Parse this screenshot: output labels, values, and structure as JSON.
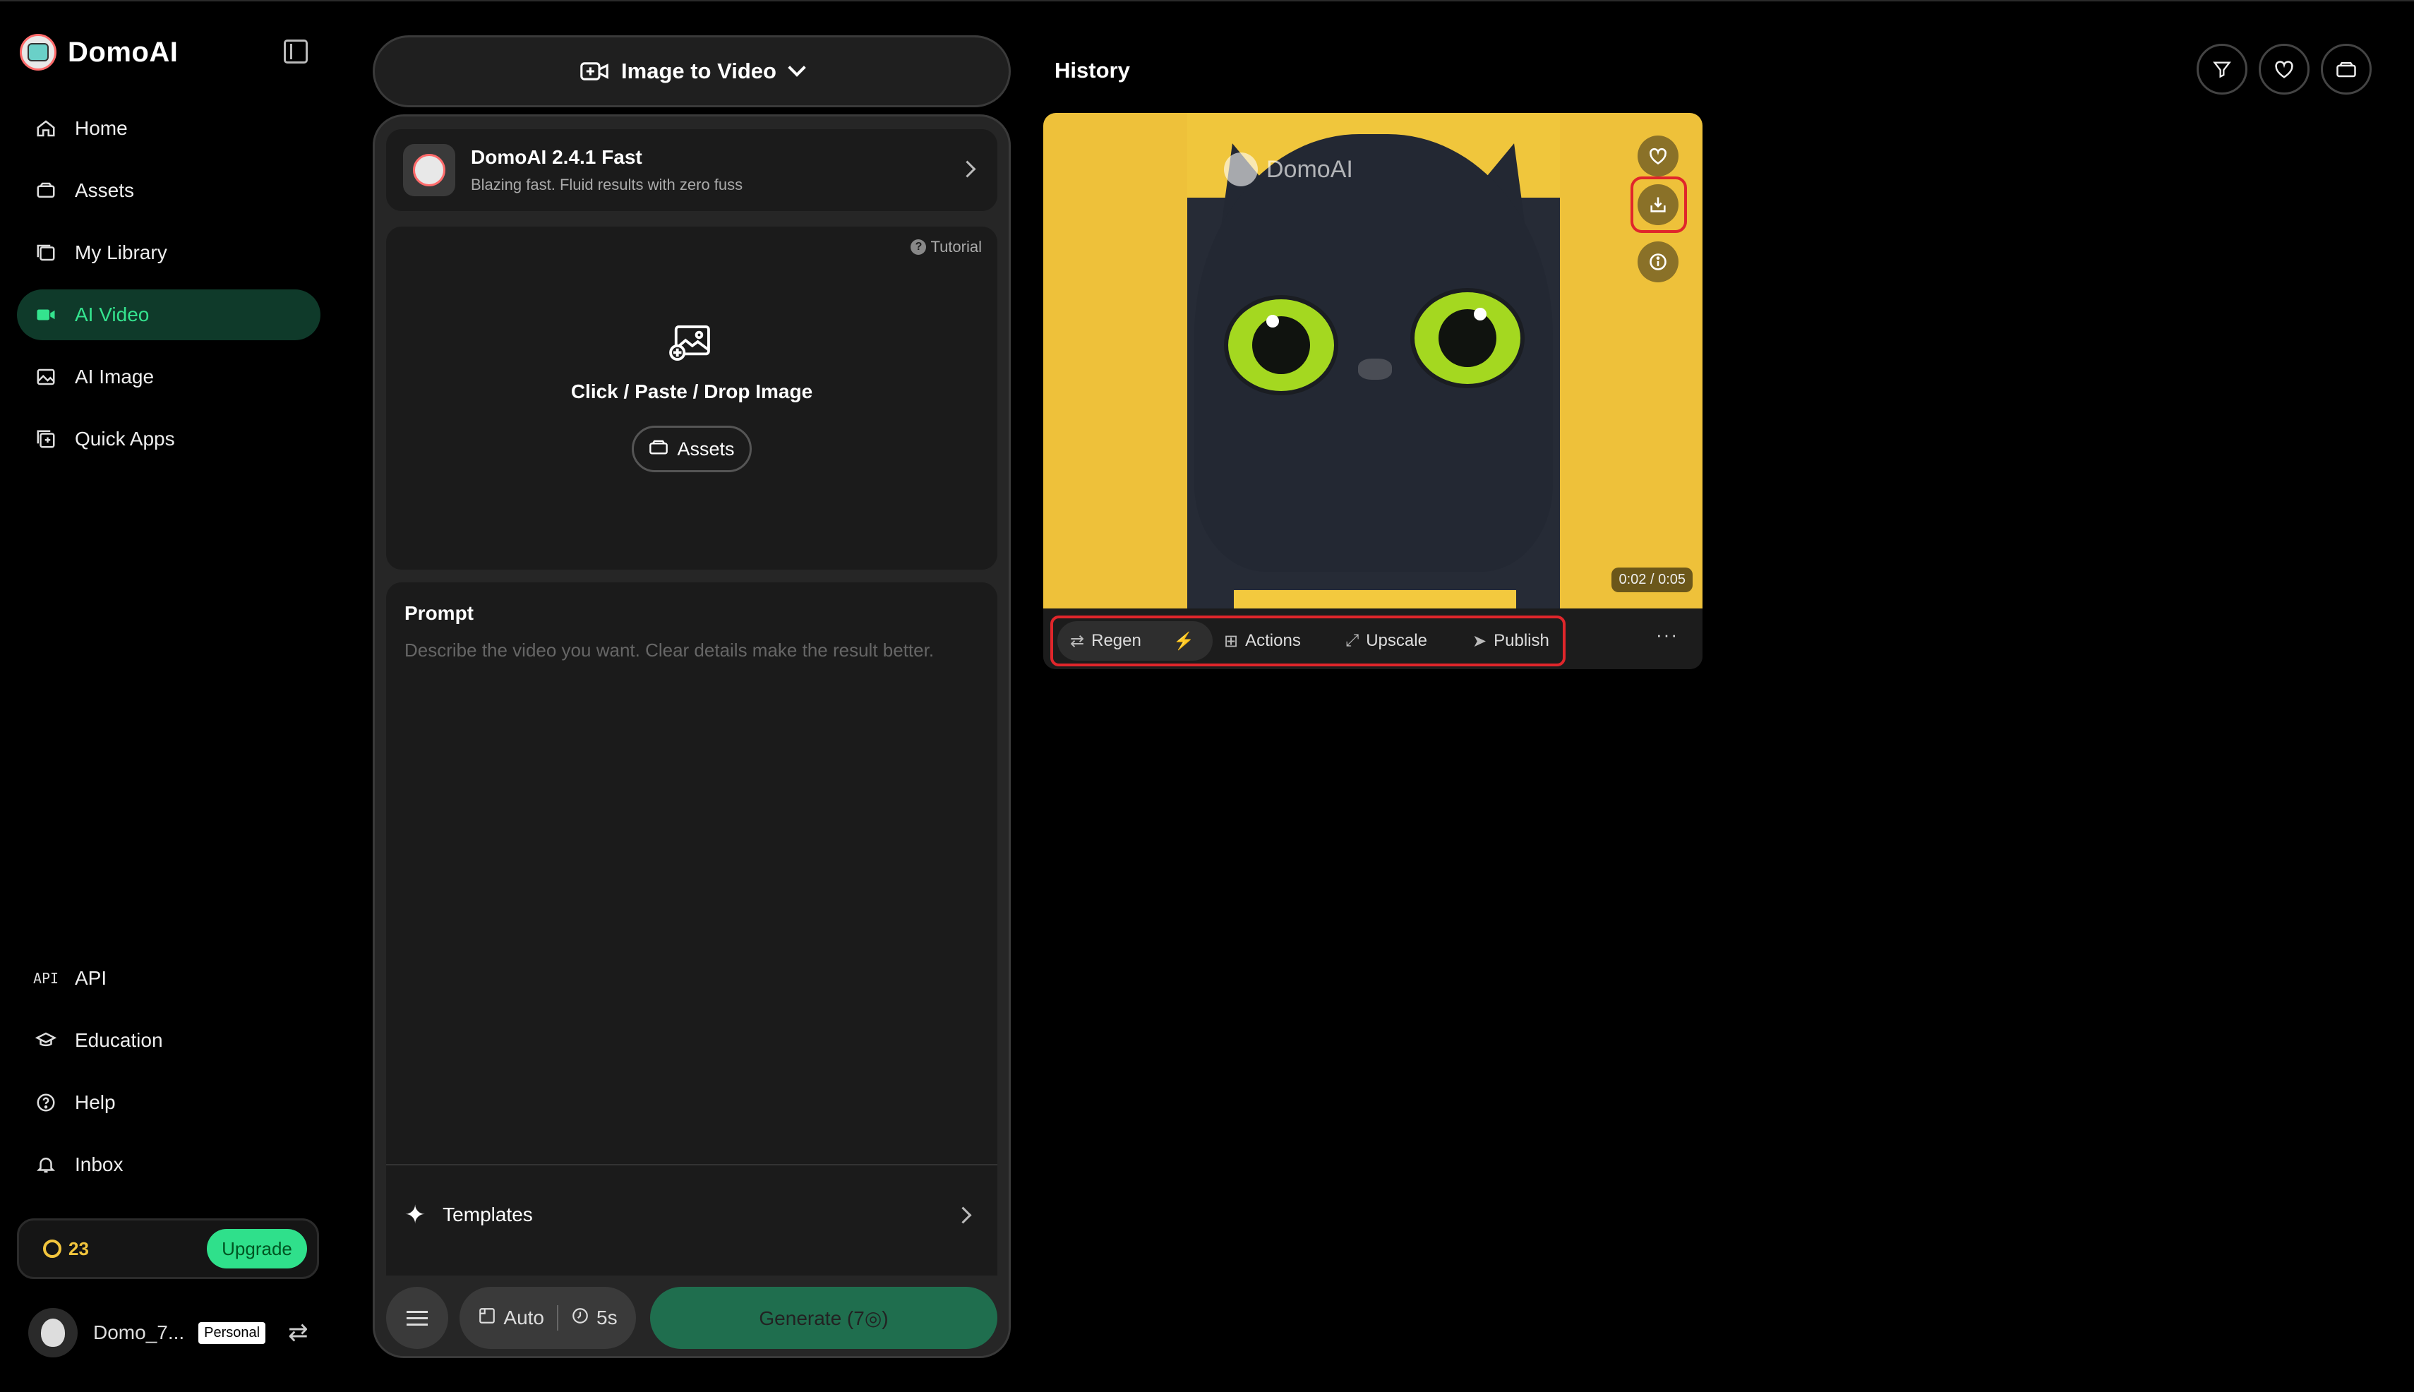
{
  "brand": {
    "name": "DomoAI"
  },
  "sidebar": {
    "nav": [
      {
        "label": "Home",
        "icon": "home-icon"
      },
      {
        "label": "Assets",
        "icon": "assets-icon"
      },
      {
        "label": "My Library",
        "icon": "library-icon"
      },
      {
        "label": "AI Video",
        "icon": "video-icon",
        "active": true
      },
      {
        "label": "AI Image",
        "icon": "image-icon"
      },
      {
        "label": "Quick Apps",
        "icon": "apps-icon"
      }
    ],
    "bottom_nav": [
      {
        "label": "API",
        "icon_text": "API"
      },
      {
        "label": "Education",
        "icon": "education-icon"
      },
      {
        "label": "Help",
        "icon": "help-icon"
      },
      {
        "label": "Inbox",
        "icon": "bell-icon"
      }
    ],
    "credits": {
      "count": "23",
      "upgrade_label": "Upgrade"
    },
    "user": {
      "name": "Domo_7...",
      "plan": "Personal"
    }
  },
  "center": {
    "mode_label": "Image to Video",
    "model": {
      "name": "DomoAI 2.4.1 Fast",
      "description": "Blazing fast. Fluid results with zero fuss"
    },
    "upload": {
      "tutorial_label": "Tutorial",
      "label": "Click / Paste / Drop Image",
      "assets_label": "Assets"
    },
    "prompt": {
      "title": "Prompt",
      "placeholder": "Describe the video you want. Clear details make the result better."
    },
    "templates_label": "Templates",
    "toolbar": {
      "ratio_label": "Auto",
      "duration_label": "5s",
      "generate_label": "Generate (7◎)"
    }
  },
  "history": {
    "title": "History",
    "item": {
      "watermark": "DomoAI",
      "timecode": "0:02 / 0:05",
      "actions": [
        "Regen",
        "Actions",
        "Upscale",
        "Publish"
      ],
      "more_label": "···"
    }
  },
  "colors": {
    "accent": "#2fe08b",
    "highlight": "#e0262b",
    "coin": "#f2c53d"
  }
}
